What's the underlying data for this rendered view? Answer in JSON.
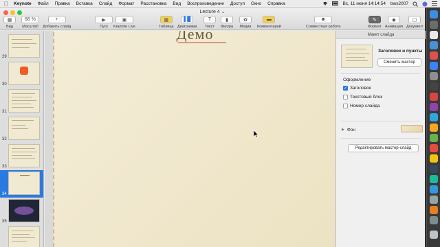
{
  "menubar": {
    "app": "Keynote",
    "items": [
      "Файл",
      "Правка",
      "Вставка",
      "Слайд",
      "Формат",
      "Расстановка",
      "Вид",
      "Воспроизведение",
      "Доступ",
      "Окно",
      "Справка"
    ],
    "datetime": "Вс, 11 июня  14:14:54",
    "user": "bws2007"
  },
  "window": {
    "title": "Lecture 4"
  },
  "toolbar": {
    "view_label": "Вид",
    "zoom_value": "88 %",
    "zoom_label": "Масштаб",
    "add_slide_label": "Добавить слайд",
    "play_label": "Пуск",
    "keynote_live_label": "Keynote Live",
    "table_label": "Таблица",
    "chart_label": "Диаграмма",
    "text_label": "Текст",
    "shape_label": "Фигура",
    "media_label": "Медиа",
    "comment_label": "Комментарий",
    "collab_label": "Совместная работа",
    "format_label": "Формат",
    "animate_label": "Анимация",
    "document_label": "Документ"
  },
  "navigator": {
    "slides": [
      {
        "number": "29"
      },
      {
        "number": "30"
      },
      {
        "number": "31"
      },
      {
        "number": "32"
      },
      {
        "number": "33"
      },
      {
        "number": "34"
      },
      {
        "number": "35"
      },
      {
        "number": "36"
      }
    ],
    "selected": "34"
  },
  "slide": {
    "title": "Демо"
  },
  "inspector": {
    "tab_label": "Макет слайда",
    "master_name": "Заголовок и пункты",
    "change_master_label": "Сменить мастер",
    "appearance_label": "Оформление",
    "checkboxes": [
      {
        "label": "Заголовок",
        "checked": true
      },
      {
        "label": "Текстовый блок",
        "checked": false
      },
      {
        "label": "Номер слайда",
        "checked": false
      }
    ],
    "background_label": "Фон",
    "edit_master_label": "Редактировать мастер-слайд"
  },
  "colors": {
    "accent": "#2a7ae2",
    "slide_bg": "#f1ead2"
  }
}
